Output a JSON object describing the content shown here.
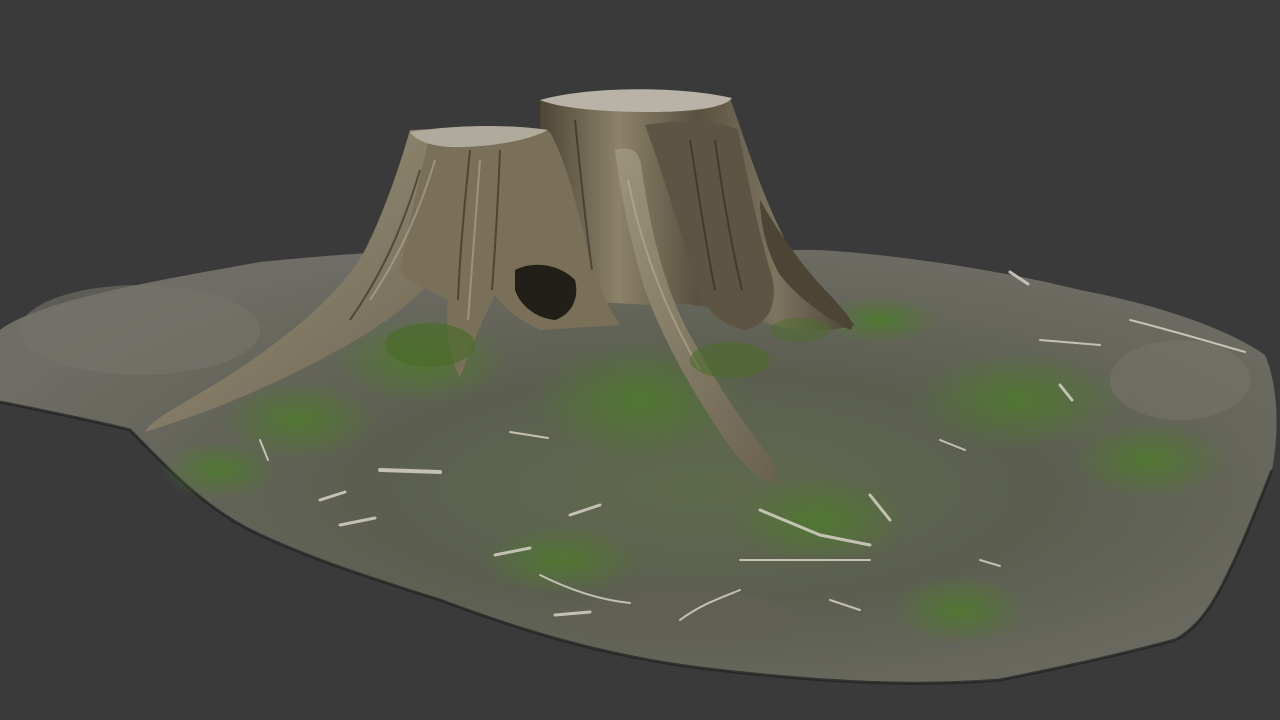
{
  "scene": {
    "subject": "tree-stump-scan",
    "colors": {
      "background": "#3a3a3a",
      "soil": "#6e6a60",
      "grass": "#56733a",
      "bark_light": "#a39a82",
      "bark_dark": "#3f3a2f",
      "debris": "#d9d6cc"
    }
  }
}
